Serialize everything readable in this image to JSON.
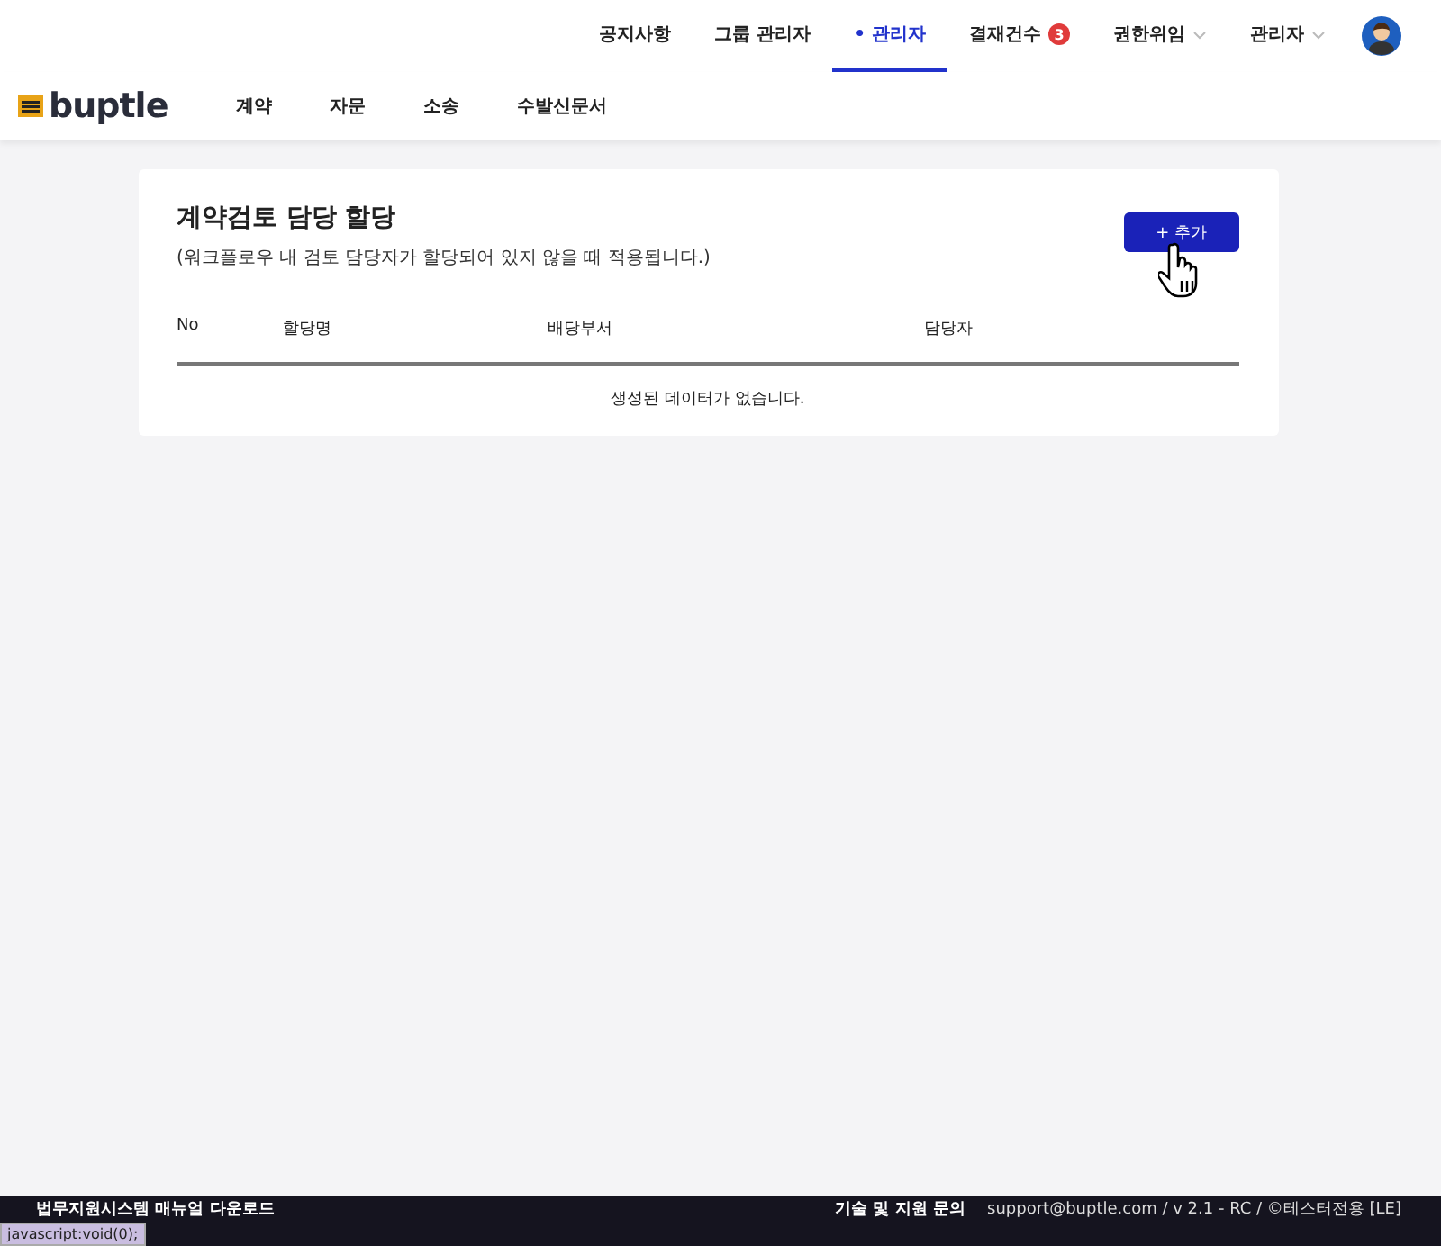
{
  "top_nav": {
    "items": [
      {
        "label": "공지사항",
        "selected": false,
        "kind": "link"
      },
      {
        "label": "그룹 관리자",
        "selected": false,
        "kind": "link"
      },
      {
        "label": "• 관리자",
        "selected": true,
        "kind": "link"
      },
      {
        "label": "결재건수",
        "selected": false,
        "kind": "badge",
        "badge": "3"
      },
      {
        "label": "권한위임",
        "selected": false,
        "kind": "dropdown"
      },
      {
        "label": "관리자",
        "selected": false,
        "kind": "dropdown"
      }
    ]
  },
  "logo": "buptle",
  "main_nav": [
    "계약",
    "자문",
    "소송",
    "수발신문서"
  ],
  "card": {
    "title": "계약검토 담당 할당",
    "subtitle": "(워크플로우 내 검토 담당자가 할당되어 있지 않을 때 적용됩니다.)",
    "add_button": "+ 추가",
    "table": {
      "columns": [
        "No",
        "할당명",
        "배당부서",
        "담당자"
      ],
      "empty_message": "생성된 데이터가 없습니다."
    }
  },
  "footer": {
    "manual_link": "법무지원시스템 매뉴얼 다운로드",
    "support_label": "기술 및 지원 문의",
    "info": "support@buptle.com / v 2.1 - RC / ©테스터전용 [LE]"
  },
  "status_url": "javascript:void(0);"
}
